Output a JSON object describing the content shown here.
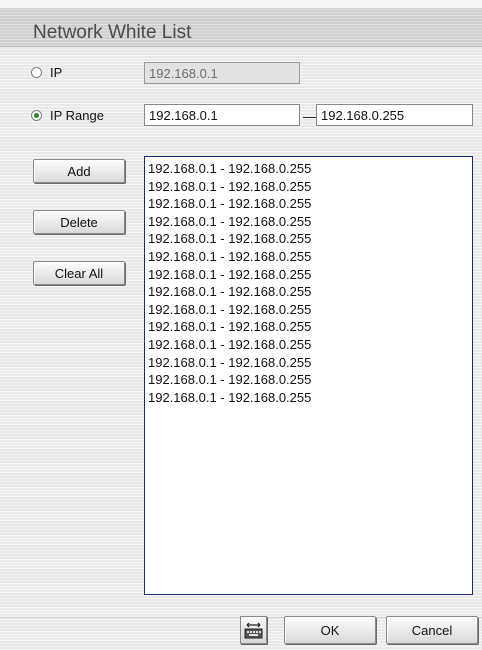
{
  "dialog": {
    "title": "Network White List"
  },
  "ip_option": {
    "label": "IP",
    "value": "192.168.0.1",
    "selected": false
  },
  "ip_range_option": {
    "label": "IP Range",
    "start": "192.168.0.1",
    "separator": "—",
    "end": "192.168.0.255",
    "selected": true
  },
  "buttons": {
    "add": "Add",
    "delete": "Delete",
    "clear_all": "Clear All",
    "ok": "OK",
    "cancel": "Cancel"
  },
  "whitelist": {
    "entries": [
      "192.168.0.1 - 192.168.0.255",
      "192.168.0.1 - 192.168.0.255",
      "192.168.0.1 - 192.168.0.255",
      "192.168.0.1 - 192.168.0.255",
      "192.168.0.1 - 192.168.0.255",
      "192.168.0.1 - 192.168.0.255",
      "192.168.0.1 - 192.168.0.255",
      "192.168.0.1 - 192.168.0.255",
      "192.168.0.1 - 192.168.0.255",
      "192.168.0.1 - 192.168.0.255",
      "192.168.0.1 - 192.168.0.255",
      "192.168.0.1 - 192.168.0.255",
      "192.168.0.1 - 192.168.0.255",
      "192.168.0.1 - 192.168.0.255"
    ]
  },
  "icons": {
    "keyboard": "keyboard-icon"
  },
  "colors": {
    "radio_selected": "#2a8a2a",
    "list_border": "#1c2a73",
    "title_text": "#4a4a4a"
  }
}
